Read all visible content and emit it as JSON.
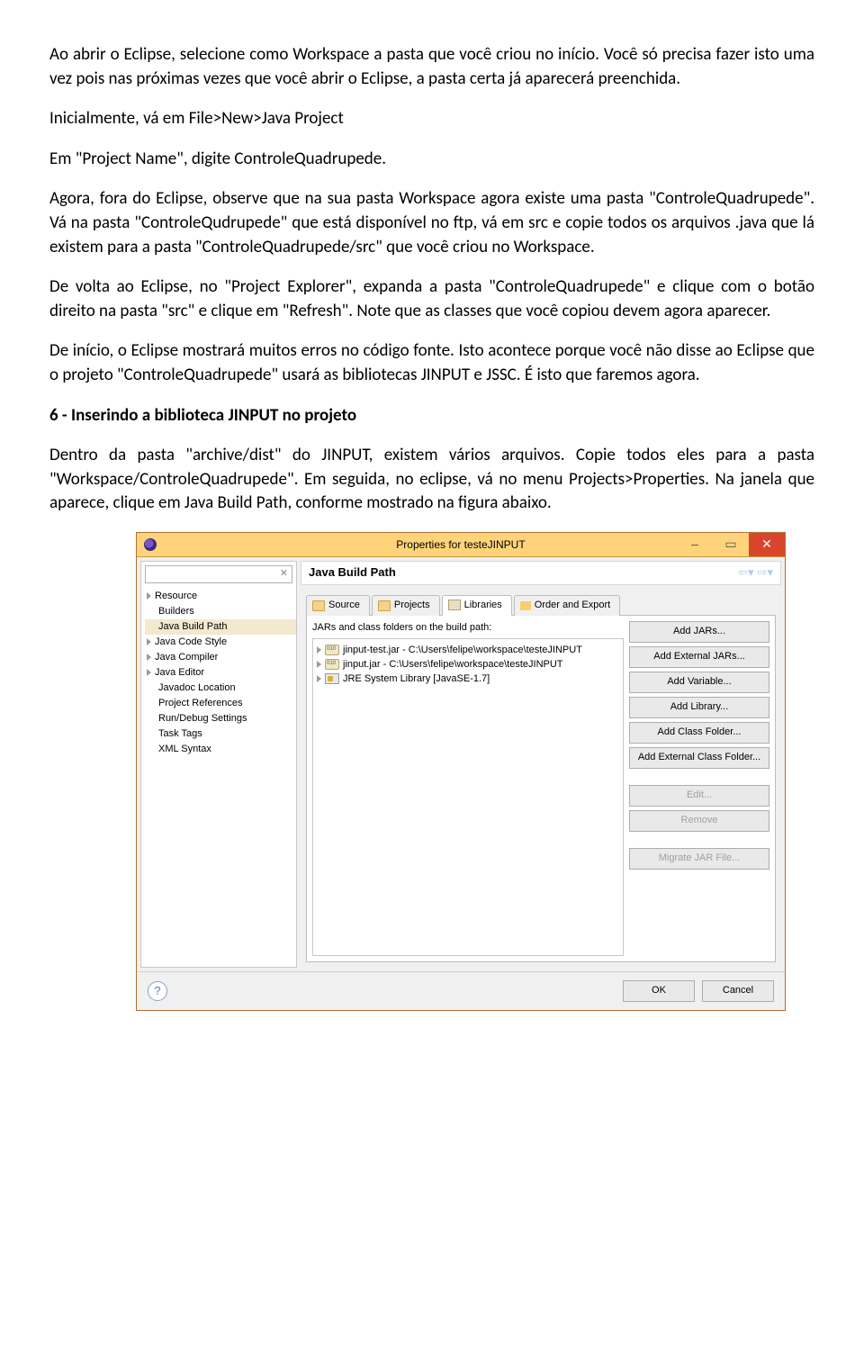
{
  "doc": {
    "p1": "Ao abrir o Eclipse, selecione como Workspace a pasta que você criou no início. Você só precisa fazer isto uma vez pois nas próximas vezes que você abrir o Eclipse, a pasta certa já aparecerá preenchida.",
    "p2": "Inicialmente, vá em File>New>Java Project",
    "p3": "Em \"Project Name\", digite ControleQuadrupede.",
    "p4": "Agora, fora do Eclipse, observe que na sua pasta Workspace agora existe uma pasta \"ControleQuadrupede\". Vá na pasta \"ControleQudrupede\" que está disponível no ftp, vá em src e copie todos os arquivos .java que lá existem para a pasta \"ControleQuadrupede/src\" que você criou no Workspace.",
    "p5": "De volta ao Eclipse, no \"Project Explorer\", expanda a pasta \"ControleQuadrupede\" e clique com o botão direito na pasta \"src\" e clique em \"Refresh\". Note que as classes que você copiou devem agora aparecer.",
    "p6": "De início, o Eclipse mostrará muitos erros no código fonte. Isto acontece porque você não disse ao Eclipse que o projeto \"ControleQuadrupede\" usará as bibliotecas JINPUT e JSSC. É isto que faremos agora.",
    "h6": "6 - Inserindo a biblioteca JINPUT no projeto",
    "p7": "Dentro da pasta \"archive/dist\" do JINPUT, existem vários arquivos. Copie todos eles para a pasta \"Workspace/ControleQuadrupede\". Em seguida, no eclipse, vá no menu Projects>Properties. Na janela que aparece, clique em Java Build Path, conforme mostrado na figura abaixo."
  },
  "dlg": {
    "title": "Properties for testeJINPUT",
    "filter_value": "",
    "tree": {
      "i0": "Resource",
      "i1": "Builders",
      "i2": "Java Build Path",
      "i3": "Java Code Style",
      "i4": "Java Compiler",
      "i5": "Java Editor",
      "i6": "Javadoc Location",
      "i7": "Project References",
      "i8": "Run/Debug Settings",
      "i9": "Task Tags",
      "i10": "XML Syntax"
    },
    "header": "Java Build Path",
    "tabs": {
      "t0": "Source",
      "t1": "Projects",
      "t2": "Libraries",
      "t3": "Order and Export"
    },
    "list_label": "JARs and class folders on the build path:",
    "list": {
      "r0": "jinput-test.jar - C:\\Users\\felipe\\workspace\\testeJINPUT",
      "r1": "jinput.jar - C:\\Users\\felipe\\workspace\\testeJINPUT",
      "r2": "JRE System Library [JavaSE-1.7]"
    },
    "btns": {
      "b0": "Add JARs...",
      "b1": "Add External JARs...",
      "b2": "Add Variable...",
      "b3": "Add Library...",
      "b4": "Add Class Folder...",
      "b5": "Add External Class Folder...",
      "b6": "Edit...",
      "b7": "Remove",
      "b8": "Migrate JAR File..."
    },
    "ok": "OK",
    "cancel": "Cancel",
    "min": "–",
    "max": "▭",
    "close": "✕",
    "help": "?",
    "clear": "✕",
    "nav_back": "⇦",
    "nav_fwd": "⇨"
  }
}
